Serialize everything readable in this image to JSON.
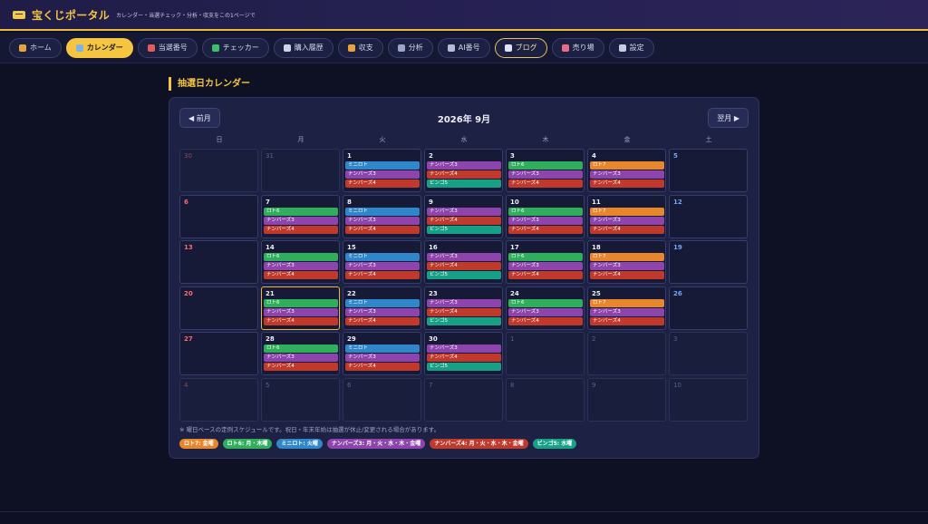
{
  "header": {
    "title": "宝くじポータル",
    "subtitle": "カレンダー・当選チェック・分析・収支をこの1ページで"
  },
  "nav": [
    {
      "label": "ホーム",
      "icon": "house-icon",
      "color": "#e8a33d",
      "state": "normal"
    },
    {
      "label": "カレンダー",
      "icon": "calendar-icon",
      "color": "#7fb3e8",
      "state": "active"
    },
    {
      "label": "当選番号",
      "icon": "target-icon",
      "color": "#e85a5a",
      "state": "normal"
    },
    {
      "label": "チェッカー",
      "icon": "checkbox-icon",
      "color": "#3bbf6b",
      "state": "normal"
    },
    {
      "label": "購入履歴",
      "icon": "receipt-icon",
      "color": "#cfd3e6",
      "state": "normal"
    },
    {
      "label": "収支",
      "icon": "money-bag-icon",
      "color": "#e8a33d",
      "state": "normal"
    },
    {
      "label": "分析",
      "icon": "bar-chart-icon",
      "color": "#9aa4c8",
      "state": "normal"
    },
    {
      "label": "AI番号",
      "icon": "robot-icon",
      "color": "#b7bcd6",
      "state": "normal"
    },
    {
      "label": "ブログ",
      "icon": "newspaper-icon",
      "color": "#dfe3f2",
      "state": "outlined"
    },
    {
      "label": "売り場",
      "icon": "shop-icon",
      "color": "#e86b8a",
      "state": "normal"
    },
    {
      "label": "設定",
      "icon": "gear-icon",
      "color": "#c9cbe0",
      "state": "normal"
    }
  ],
  "section_title": "抽選日カレンダー",
  "calendar": {
    "prev_label": "◀ 前月",
    "next_label": "翌月 ▶",
    "month_label": "2026年 9月",
    "weekdays": [
      "日",
      "月",
      "火",
      "水",
      "木",
      "金",
      "土"
    ],
    "weeks": [
      [
        {
          "day": "30",
          "other": true,
          "tags": []
        },
        {
          "day": "31",
          "other": true,
          "tags": []
        },
        {
          "day": "1",
          "tags": [
            "mini",
            "n3",
            "n4"
          ]
        },
        {
          "day": "2",
          "tags": [
            "n3",
            "n4",
            "bingo"
          ]
        },
        {
          "day": "3",
          "tags": [
            "l6",
            "n3",
            "n4"
          ]
        },
        {
          "day": "4",
          "tags": [
            "l7",
            "n3",
            "n4"
          ]
        },
        {
          "day": "5",
          "tags": []
        }
      ],
      [
        {
          "day": "6",
          "tags": []
        },
        {
          "day": "7",
          "tags": [
            "l6",
            "n3",
            "n4"
          ]
        },
        {
          "day": "8",
          "tags": [
            "mini",
            "n3",
            "n4"
          ]
        },
        {
          "day": "9",
          "tags": [
            "n3",
            "n4",
            "bingo"
          ]
        },
        {
          "day": "10",
          "tags": [
            "l6",
            "n3",
            "n4"
          ]
        },
        {
          "day": "11",
          "tags": [
            "l7",
            "n3",
            "n4"
          ]
        },
        {
          "day": "12",
          "tags": []
        }
      ],
      [
        {
          "day": "13",
          "tags": []
        },
        {
          "day": "14",
          "tags": [
            "l6",
            "n3",
            "n4"
          ]
        },
        {
          "day": "15",
          "tags": [
            "mini",
            "n3",
            "n4"
          ]
        },
        {
          "day": "16",
          "tags": [
            "n3",
            "n4",
            "bingo"
          ]
        },
        {
          "day": "17",
          "tags": [
            "l6",
            "n3",
            "n4"
          ]
        },
        {
          "day": "18",
          "tags": [
            "l7",
            "n3",
            "n4"
          ]
        },
        {
          "day": "19",
          "tags": []
        }
      ],
      [
        {
          "day": "20",
          "tags": []
        },
        {
          "day": "21",
          "today": true,
          "tags": [
            "l6",
            "n3",
            "n4"
          ]
        },
        {
          "day": "22",
          "tags": [
            "mini",
            "n3",
            "n4"
          ]
        },
        {
          "day": "23",
          "tags": [
            "n3",
            "n4",
            "bingo"
          ]
        },
        {
          "day": "24",
          "tags": [
            "l6",
            "n3",
            "n4"
          ]
        },
        {
          "day": "25",
          "tags": [
            "l7",
            "n3",
            "n4"
          ]
        },
        {
          "day": "26",
          "tags": []
        }
      ],
      [
        {
          "day": "27",
          "tags": []
        },
        {
          "day": "28",
          "tags": [
            "l6",
            "n3",
            "n4"
          ]
        },
        {
          "day": "29",
          "tags": [
            "mini",
            "n3",
            "n4"
          ]
        },
        {
          "day": "30",
          "tags": [
            "n3",
            "n4",
            "bingo"
          ]
        },
        {
          "day": "1",
          "other": true,
          "tags": []
        },
        {
          "day": "2",
          "other": true,
          "tags": []
        },
        {
          "day": "3",
          "other": true,
          "tags": []
        }
      ],
      [
        {
          "day": "4",
          "other": true,
          "tags": []
        },
        {
          "day": "5",
          "other": true,
          "tags": []
        },
        {
          "day": "6",
          "other": true,
          "tags": []
        },
        {
          "day": "7",
          "other": true,
          "tags": []
        },
        {
          "day": "8",
          "other": true,
          "tags": []
        },
        {
          "day": "9",
          "other": true,
          "tags": []
        },
        {
          "day": "10",
          "other": true,
          "tags": []
        }
      ]
    ]
  },
  "tag_types": {
    "l6": {
      "label": "ロト6",
      "color": "#2fae5c"
    },
    "l7": {
      "label": "ロト7",
      "color": "#e8862c"
    },
    "mini": {
      "label": "ミニロト",
      "color": "#2f86c9"
    },
    "n3": {
      "label": "ナンバーズ3",
      "color": "#8e44ad"
    },
    "n4": {
      "label": "ナンバーズ4",
      "color": "#c0392b"
    },
    "bingo": {
      "label": "ビンゴ5",
      "color": "#16a085"
    }
  },
  "note": "※ 曜日ベースの定例スケジュールです。祝日・年末年始は抽選が休止/変更される場合があります。",
  "legend": [
    {
      "label": "ロト7: 金曜",
      "color": "#e8862c"
    },
    {
      "label": "ロト6: 月・木曜",
      "color": "#2fae5c"
    },
    {
      "label": "ミニロト: 火曜",
      "color": "#2f86c9"
    },
    {
      "label": "ナンバーズ3: 月・火・水・木・金曜",
      "color": "#8e44ad"
    },
    {
      "label": "ナンバーズ4: 月・火・水・木・金曜",
      "color": "#c0392b"
    },
    {
      "label": "ビンゴ5: 水曜",
      "color": "#16a085"
    }
  ]
}
